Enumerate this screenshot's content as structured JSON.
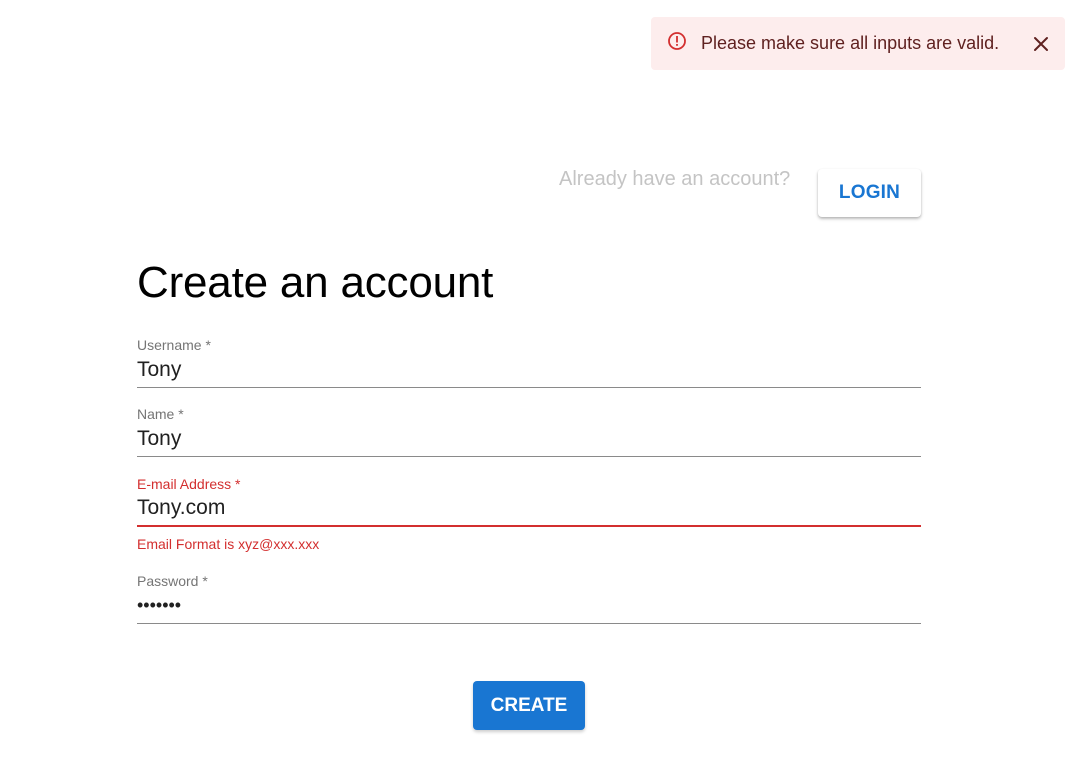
{
  "alert": {
    "message": "Please make sure all inputs are valid.",
    "icon": "error-outline-icon",
    "close_icon": "close-icon",
    "color": "#d32f2f",
    "background": "#fdeded"
  },
  "header": {
    "prompt": "Already have an account?",
    "login_label": "LOGIN"
  },
  "form": {
    "title": "Create an account",
    "fields": [
      {
        "label": "Username *",
        "value": "Tony",
        "type": "text",
        "error": false
      },
      {
        "label": "Name *",
        "value": "Tony",
        "type": "text",
        "error": false
      },
      {
        "label": "E-mail Address *",
        "value": "Tony.com",
        "type": "text",
        "error": true,
        "helper": "Email Format is xyz@xxx.xxx"
      },
      {
        "label": "Password *",
        "value": "•••••••",
        "type": "password",
        "error": false
      }
    ],
    "submit_label": "CREATE"
  },
  "colors": {
    "primary": "#1976d2",
    "error": "#d32f2f",
    "muted": "#c4c4c4"
  }
}
